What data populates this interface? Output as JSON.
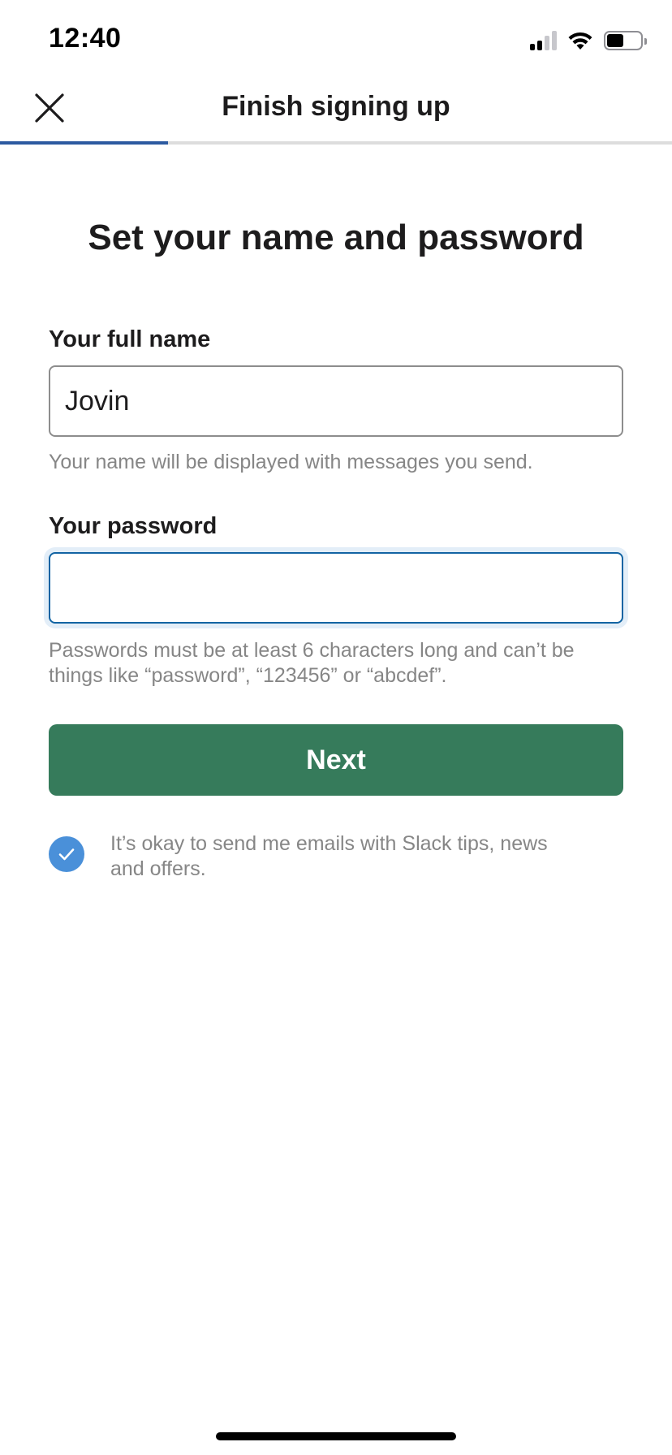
{
  "status_bar": {
    "time": "12:40",
    "battery_level": 0.5
  },
  "nav": {
    "title": "Finish signing up",
    "close_icon": "close-icon"
  },
  "progress": {
    "fraction": 0.25,
    "fill_color": "#2c5aa0"
  },
  "main": {
    "heading": "Set your name and password",
    "full_name": {
      "label": "Your full name",
      "value": "Jovin",
      "hint": "Your name will be displayed with messages you send."
    },
    "password": {
      "label": "Your password",
      "value": "",
      "hint": "Passwords must be at least 6 characters long and can’t be things like “password”, “123456” or “abcdef”."
    },
    "next_button": {
      "label": "Next",
      "color": "#367b5b"
    },
    "consent": {
      "checked": true,
      "text": "It’s okay to send me emails with Slack tips, news and offers.",
      "check_color": "#4a90d9"
    }
  }
}
